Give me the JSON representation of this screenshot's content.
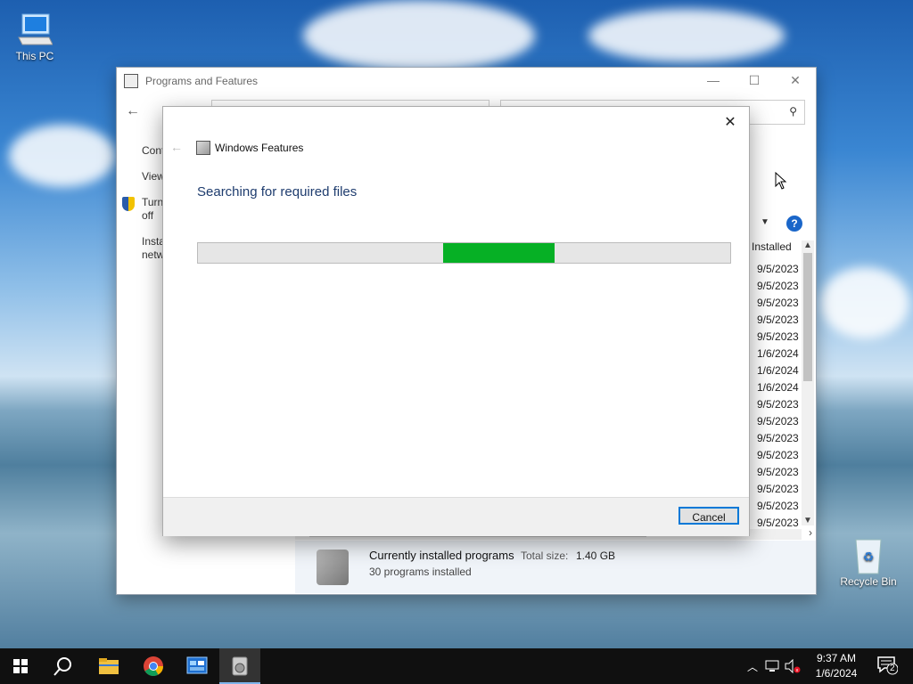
{
  "desktop": {
    "icons": [
      {
        "label": "This PC"
      },
      {
        "label": "Recycle Bin"
      }
    ]
  },
  "programs_window": {
    "title": "Programs and Features",
    "controls": {
      "minimize": "—",
      "maximize": "☐",
      "close": "✕"
    },
    "sidebar": {
      "item1": "Cont",
      "item2": "View",
      "item3_l1": "Turn",
      "item3_l2": "off",
      "item4_l1": "Insta",
      "item4_l2": "netw"
    },
    "column_header": "Installed",
    "help": "?",
    "dates": [
      "9/5/2023",
      "9/5/2023",
      "9/5/2023",
      "9/5/2023",
      "9/5/2023",
      "1/6/2024",
      "1/6/2024",
      "1/6/2024",
      "9/5/2023",
      "9/5/2023",
      "9/5/2023",
      "9/5/2023",
      "9/5/2023",
      "9/5/2023",
      "9/5/2023",
      "9/5/2023"
    ],
    "status": {
      "title": "Currently installed programs",
      "total_label": "Total size:",
      "total_value": "1.40 GB",
      "count": "30 programs installed"
    }
  },
  "features_dialog": {
    "title": "Windows Features",
    "heading": "Searching for required files",
    "progress": {
      "segment_start": 0.46,
      "segment_end": 0.67
    },
    "cancel_label": "Cancel"
  },
  "taskbar": {
    "clock_time": "9:37 AM",
    "clock_date": "1/6/2024",
    "notification_count": "2"
  },
  "colors": {
    "progress_fill": "#06b025",
    "accent": "#0078d7",
    "heading": "#1e3c6e"
  }
}
